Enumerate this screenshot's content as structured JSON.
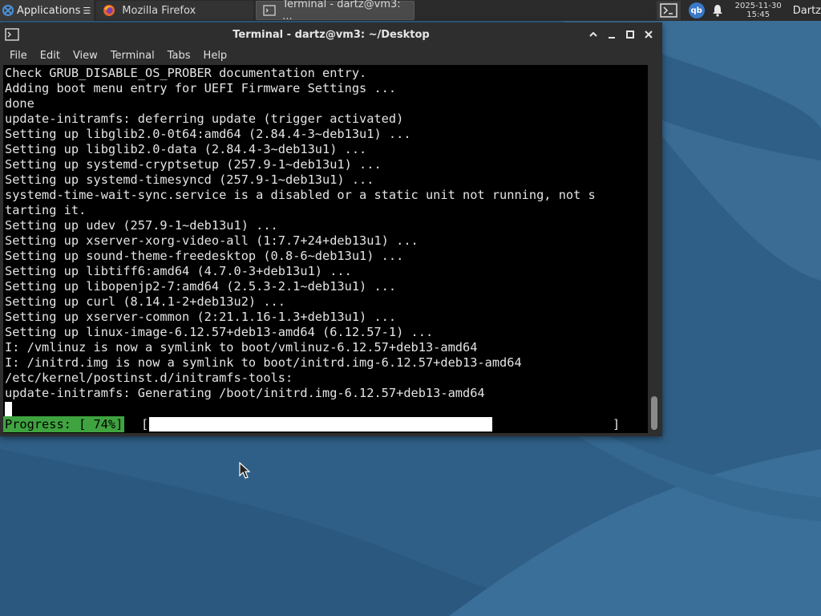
{
  "panel": {
    "applications_label": "Applications",
    "tasks": [
      {
        "label": "Mozilla Firefox",
        "icon": "firefox-icon"
      },
      {
        "label": "Terminal - dartz@vm3: ...",
        "icon": "terminal-icon"
      }
    ],
    "qb_label": "qb",
    "clock_date": "2025-11-30",
    "clock_time": "15:45",
    "user_label": "Dartz"
  },
  "window": {
    "title": "Terminal - dartz@vm3: ~/Desktop",
    "menu": [
      "File",
      "Edit",
      "View",
      "Terminal",
      "Tabs",
      "Help"
    ]
  },
  "terminal": {
    "lines": [
      "Check GRUB_DISABLE_OS_PROBER documentation entry.",
      "Adding boot menu entry for UEFI Firmware Settings ...",
      "done",
      "update-initramfs: deferring update (trigger activated)",
      "Setting up libglib2.0-0t64:amd64 (2.84.4-3~deb13u1) ...",
      "Setting up libglib2.0-data (2.84.4-3~deb13u1) ...",
      "Setting up systemd-cryptsetup (257.9-1~deb13u1) ...",
      "Setting up systemd-timesyncd (257.9-1~deb13u1) ...",
      "systemd-time-wait-sync.service is a disabled or a static unit not running, not s",
      "tarting it.",
      "Setting up udev (257.9-1~deb13u1) ...",
      "Setting up xserver-xorg-video-all (1:7.7+24+deb13u1) ...",
      "Setting up sound-theme-freedesktop (0.8-6~deb13u1) ...",
      "Setting up libtiff6:amd64 (4.7.0-3+deb13u1) ...",
      "Setting up libopenjp2-7:amd64 (2.5.3-2.1~deb13u1) ...",
      "Setting up curl (8.14.1-2+deb13u2) ...",
      "Setting up xserver-common (2:21.1.16-1.3+deb13u1) ...",
      "Setting up linux-image-6.12.57+deb13-amd64 (6.12.57-1) ...",
      "I: /vmlinuz is now a symlink to boot/vmlinuz-6.12.57+deb13-amd64",
      "I: /initrd.img is now a symlink to boot/initrd.img-6.12.57+deb13-amd64",
      "/etc/kernel/postinst.d/initramfs-tools:",
      "update-initramfs: Generating /boot/initrd.img-6.12.57+deb13-amd64"
    ],
    "progress_label": "Progress: [ 74%]",
    "bracket_open": "[",
    "bracket_close": "]",
    "progress_fraction": 0.74
  },
  "colors": {
    "progress_green": "#3fa33f",
    "terminal_bg": "#000000",
    "panel_bg": "#2b2b2b"
  }
}
